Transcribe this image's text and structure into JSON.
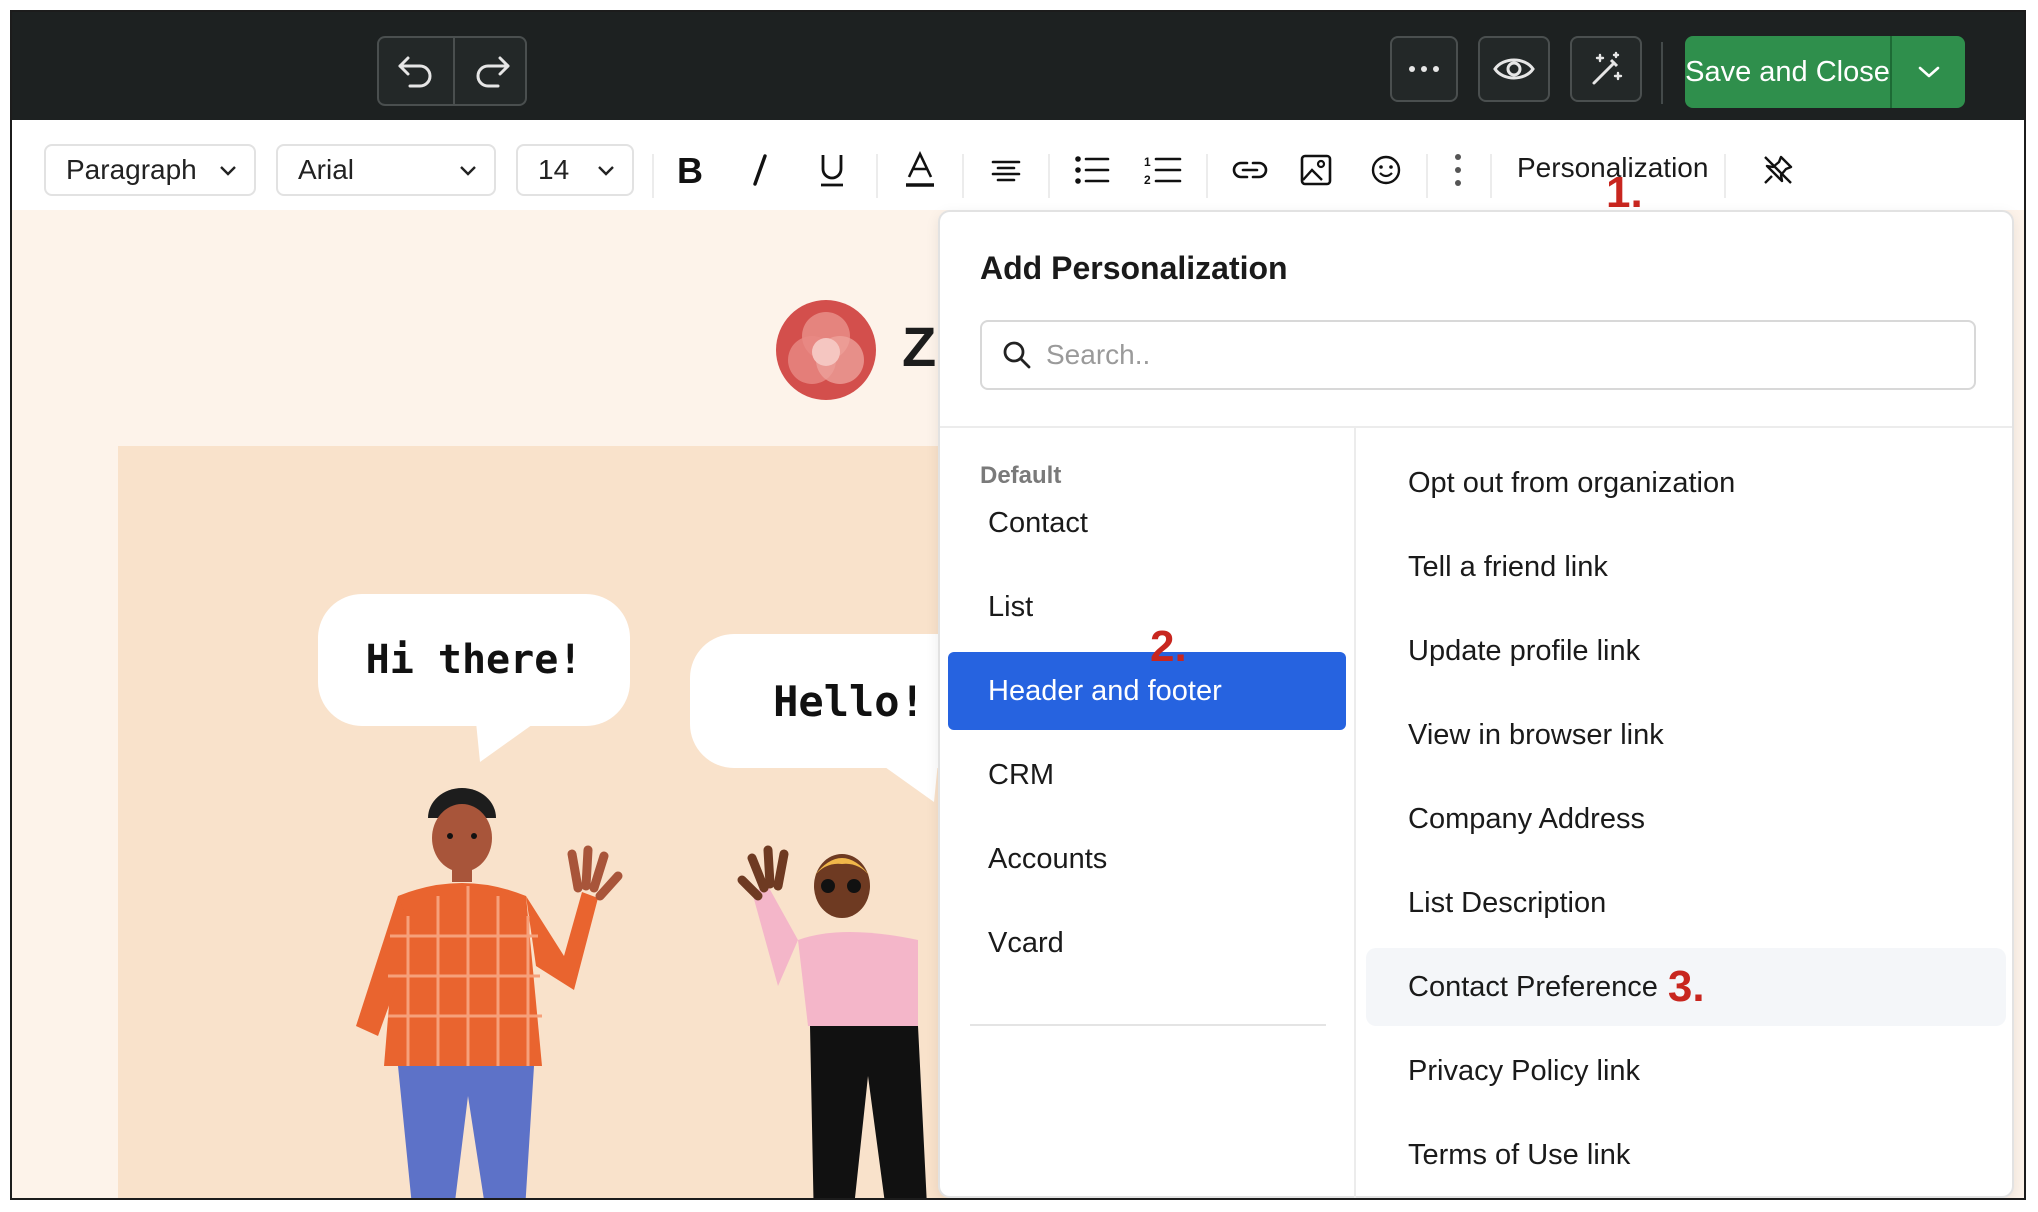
{
  "topbar": {
    "save_label": "Save and Close",
    "icons": [
      "undo-icon",
      "redo-icon",
      "more-icon",
      "preview-eye-icon",
      "magic-wand-icon",
      "chevron-down-icon"
    ]
  },
  "toolbar": {
    "paragraph": "Paragraph",
    "font": "Arial",
    "size": "14",
    "personalization": "Personalization",
    "icons": [
      "bold-icon",
      "italic-icon",
      "underline-icon",
      "text-color-icon",
      "align-center-icon",
      "bullet-list-icon",
      "numbered-list-icon",
      "link-icon",
      "image-icon",
      "emoji-icon",
      "more-vertical-icon",
      "unpin-icon"
    ]
  },
  "markers": {
    "m1": "1.",
    "m2": "2.",
    "m3": "3."
  },
  "canvas": {
    "logo_letter": "Z",
    "bubble1": "Hi there!",
    "bubble2": "Hello!"
  },
  "popup": {
    "title": "Add Personalization",
    "search_placeholder": "Search..",
    "category_heading": "Default",
    "categories": [
      "Contact",
      "List",
      "Header and footer",
      "CRM",
      "Accounts",
      "Vcard"
    ],
    "selected_category": "Header and footer",
    "fields": [
      "Opt out from organization",
      "Tell a friend link",
      "Update profile link",
      "View in browser link",
      "Company Address",
      "List Description",
      "Contact Preference",
      "Privacy Policy link",
      "Terms of Use link"
    ],
    "hovered_field": "Contact Preference"
  },
  "colors": {
    "topbar_bg": "#1d2121",
    "save_button": "#2f8f4c",
    "selected_category": "#2663e0",
    "marker_red": "#c8261f",
    "canvas_bg": "#fdf3ea"
  }
}
